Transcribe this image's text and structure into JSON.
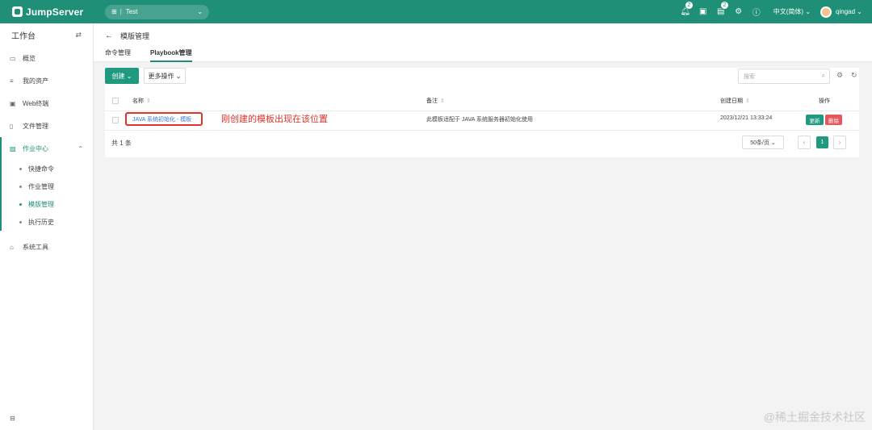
{
  "topbar": {
    "brand": "JumpServer",
    "org_icon": "org-icon",
    "org_sep": "|",
    "org_name": "Test",
    "notifications_badge": "2",
    "tasks_badge": "2",
    "language": "中文(简体)",
    "username": "qingad"
  },
  "sidebar": {
    "title": "工作台",
    "items": [
      {
        "label": "概览",
        "icon": "dashboard-icon"
      },
      {
        "label": "我的资产",
        "icon": "assets-icon"
      },
      {
        "label": "Web终端",
        "icon": "terminal-icon"
      },
      {
        "label": "文件管理",
        "icon": "file-icon"
      },
      {
        "label": "作业中心",
        "icon": "job-icon"
      },
      {
        "label": "系统工具",
        "icon": "tools-icon"
      }
    ],
    "sub_items": [
      {
        "label": "快捷命令",
        "active": false
      },
      {
        "label": "作业管理",
        "active": false
      },
      {
        "label": "模版管理",
        "active": true
      },
      {
        "label": "执行历史",
        "active": false
      }
    ]
  },
  "header": {
    "title": "模版管理",
    "tabs": [
      "命令管理",
      "Playbook管理"
    ],
    "active_tab": 1
  },
  "toolbar": {
    "create_label": "创建",
    "more_label": "更多操作",
    "search_placeholder": "搜索"
  },
  "table": {
    "columns": [
      "名称",
      "备注",
      "创建日期",
      "操作"
    ],
    "rows": [
      {
        "name": "JAVA 系统初始化 - 模板",
        "comment": "此模板适配于 JAVA 系统服务器初始化使用",
        "date": "2023/12/21 13:33:24",
        "update_label": "更新",
        "delete_label": "删除"
      }
    ]
  },
  "annotation": "刚创建的模板出现在该位置",
  "pagination": {
    "total": "共 1 条",
    "page_size": "50条/页",
    "current": "1"
  },
  "watermark": "@稀土掘金技术社区",
  "colors": {
    "primary": "#1f8f77",
    "danger": "#e5575b",
    "annotation": "#e0342c"
  }
}
